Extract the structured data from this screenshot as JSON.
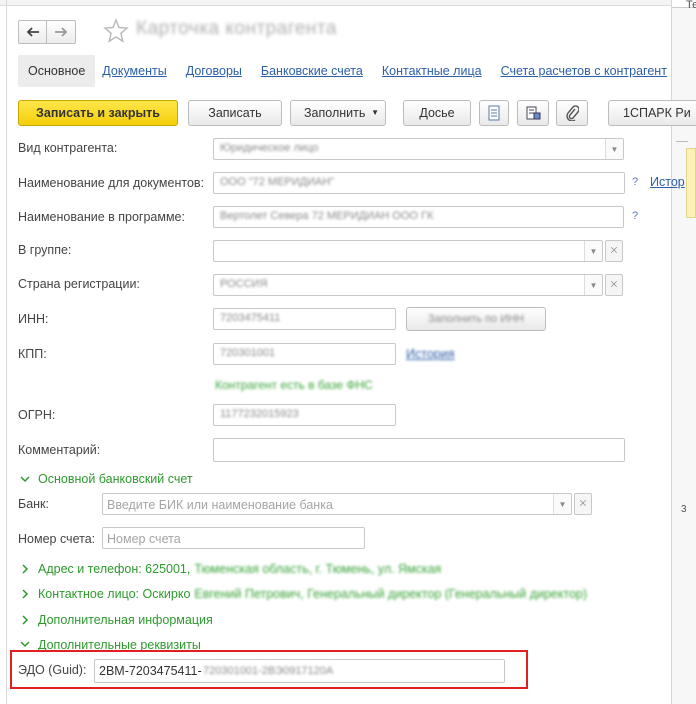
{
  "window": {
    "title": "Карточка контрагента",
    "right_panel_label": "Те",
    "right_panel_number": "3"
  },
  "nav": {
    "back_icon": "arrow-left-icon",
    "forward_icon": "arrow-right-icon",
    "favorite_icon": "star-icon"
  },
  "tabs": [
    {
      "label": "Основное"
    },
    {
      "label": "Документы"
    },
    {
      "label": "Договоры"
    },
    {
      "label": "Банковские счета"
    },
    {
      "label": "Контактные лица"
    },
    {
      "label": "Счета расчетов с контрагент"
    }
  ],
  "toolbar": {
    "save_close": "Записать и закрыть",
    "save": "Записать",
    "fill": "Заполнить",
    "dossier": "Досье",
    "spark": "1СПАРК Ри"
  },
  "form": {
    "kind_label": "Вид контрагента:",
    "docname_label": "Наименование для документов:",
    "history_link": "Истор",
    "progname_label": "Наименование в программе:",
    "group_label": "В группе:",
    "country_label": "Страна регистрации:",
    "inn_label": "ИНН:",
    "kpp_label": "КПП:",
    "ogrn_label": "ОГРН:",
    "comment_label": "Комментарий:",
    "bank_section": "Основной банковский счет",
    "bank_label": "Банк:",
    "bank_placeholder": "Введите БИК или наименование банка",
    "account_label": "Номер счета:",
    "account_placeholder": "Номер счета",
    "address_prefix": "Адрес и телефон: 625001,",
    "contact_prefix": "Контактное лицо: Оскирко",
    "additional_info": "Дополнительная информация",
    "additional_props": "Дополнительные реквизиты",
    "edo_label": "ЭДО (Guid):",
    "edo_value": "2BM-7203475411-"
  },
  "colors": {
    "accent_yellow": "#f5cf0b",
    "link_blue": "#2d5fa8",
    "section_green": "#2e9a2e",
    "highlight_red": "#e02020"
  }
}
